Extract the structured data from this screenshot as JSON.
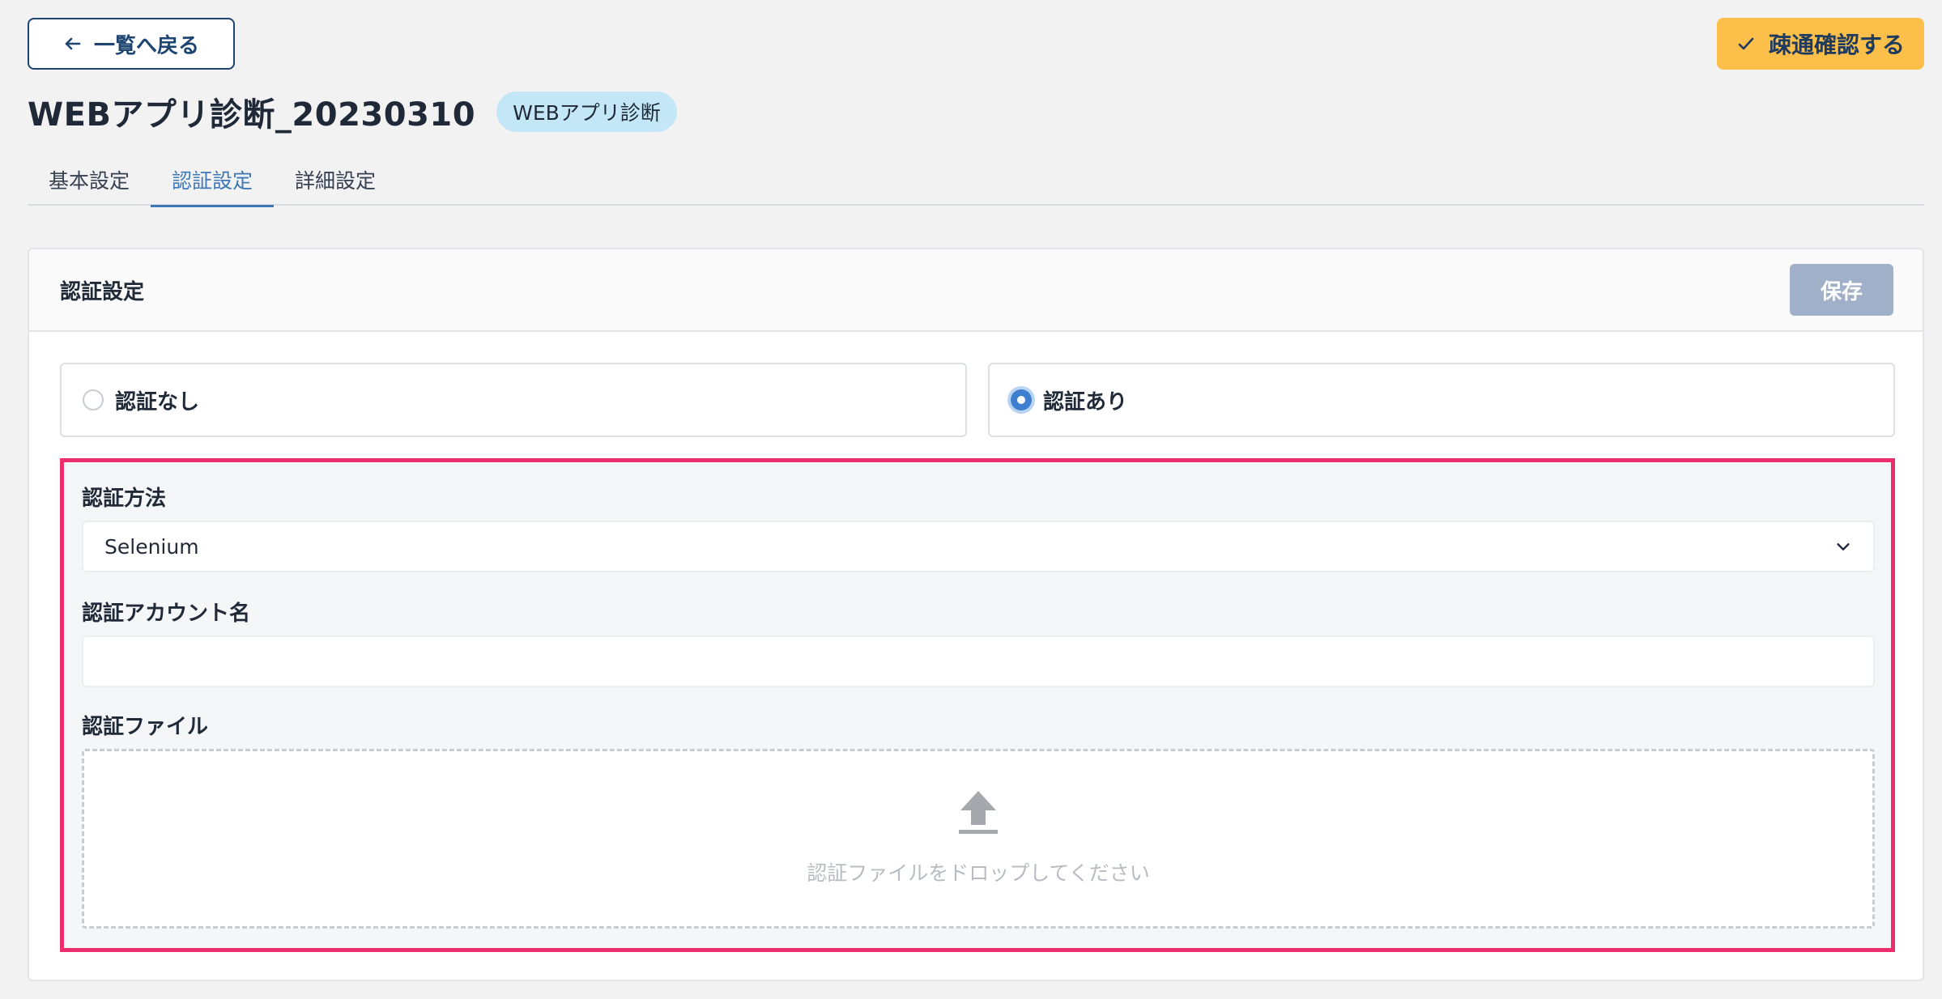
{
  "header": {
    "back_label": "一覧へ戻る",
    "confirm_label": "疎通確認する",
    "title": "WEBアプリ診断_20230310",
    "badge": "WEBアプリ診断"
  },
  "tabs": [
    {
      "label": "基本設定",
      "active": false
    },
    {
      "label": "認証設定",
      "active": true
    },
    {
      "label": "詳細設定",
      "active": false
    }
  ],
  "card": {
    "title": "認証設定",
    "save_label": "保存",
    "options": [
      {
        "label": "認証なし",
        "checked": false
      },
      {
        "label": "認証あり",
        "checked": true
      }
    ],
    "auth_method": {
      "label": "認証方法",
      "value": "Selenium"
    },
    "account": {
      "label": "認証アカウント名",
      "value": ""
    },
    "file": {
      "label": "認証ファイル",
      "drop_text": "認証ファイルをドロップしてください"
    }
  },
  "colors": {
    "accent": "#3f78b4",
    "confirm_bg": "#fcc04a",
    "save_bg": "#a0b0c8",
    "highlight_border": "#ec2f6c",
    "badge_bg": "#c4e7f7"
  },
  "icons": [
    "arrow-left-icon",
    "check-icon",
    "chevron-down-icon",
    "upload-icon"
  ]
}
